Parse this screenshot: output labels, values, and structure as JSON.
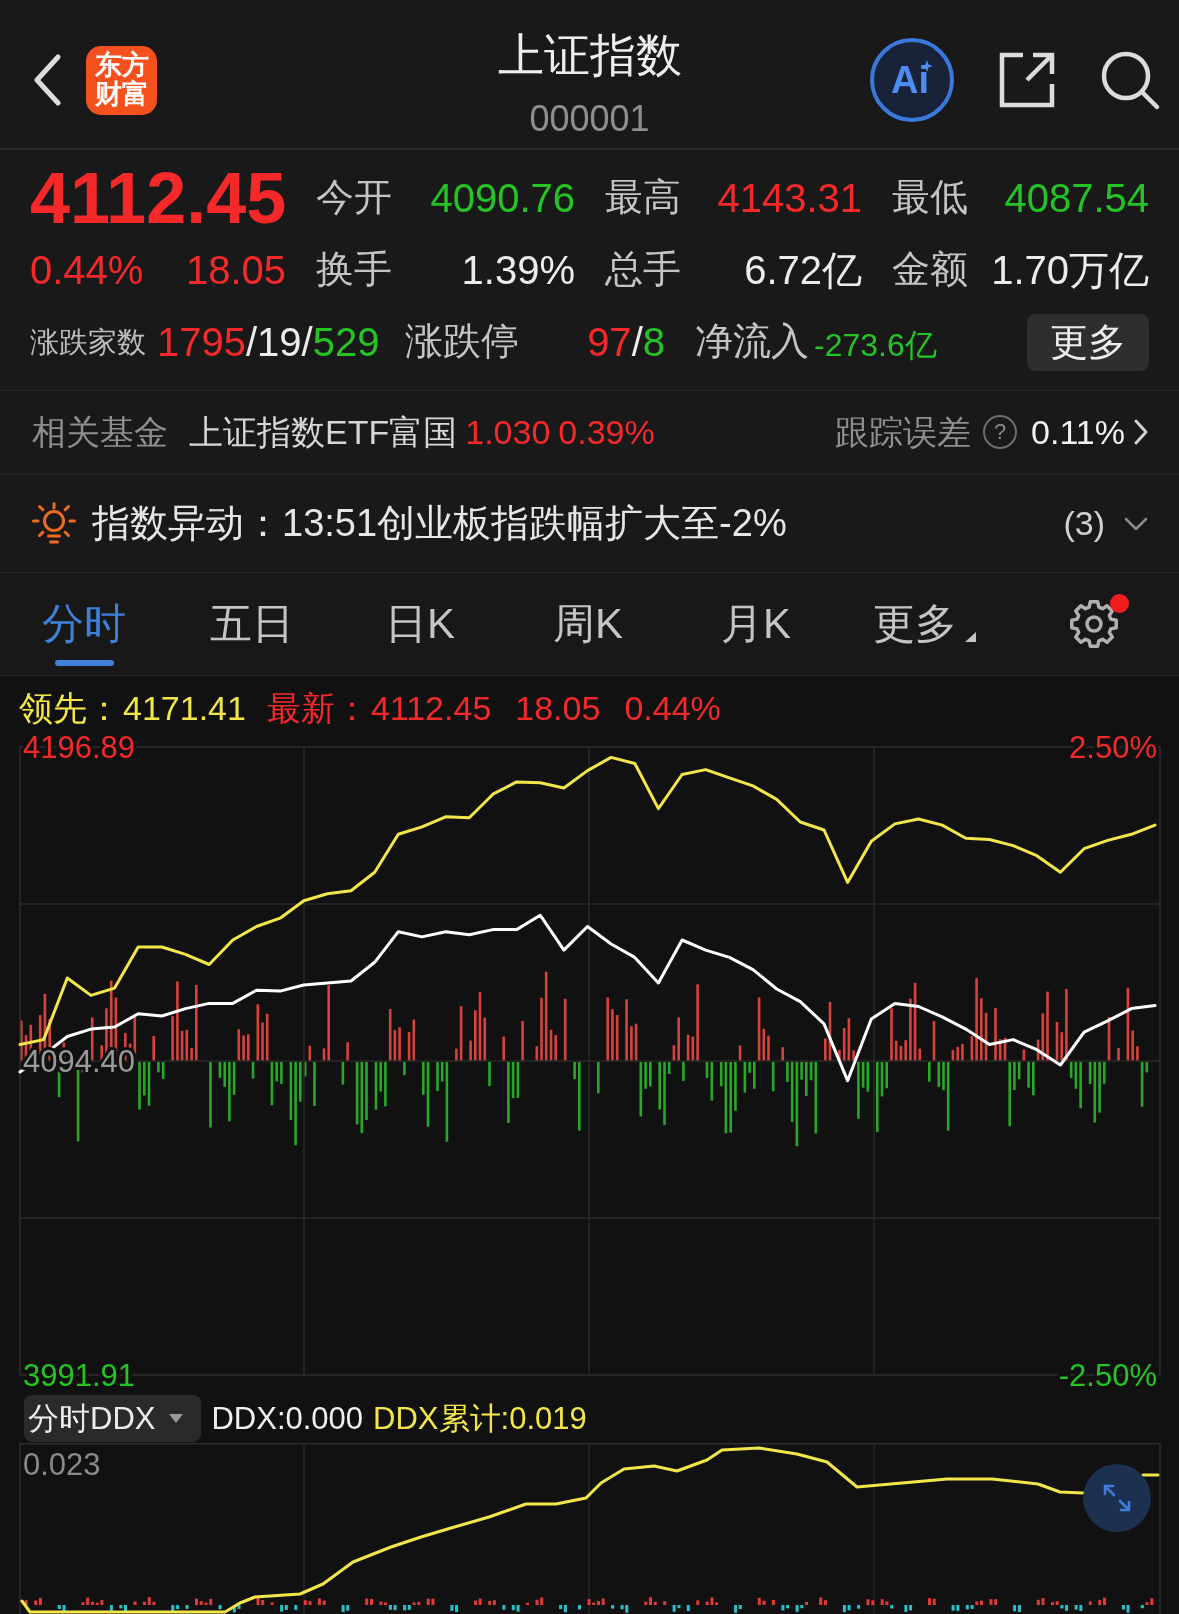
{
  "header": {
    "logo": "东方财富",
    "title": "上证指数",
    "code": "000001",
    "ai_label": "Ai"
  },
  "quote": {
    "price": "4112.45",
    "change_percent": "0.44%",
    "change": "18.05",
    "color": "#f5282a",
    "stats": [
      {
        "label": "今开",
        "value": "4090.76",
        "color": "#25c425"
      },
      {
        "label": "最高",
        "value": "4143.31",
        "color": "#f5282a"
      },
      {
        "label": "最低",
        "value": "4087.54",
        "color": "#25c425"
      },
      {
        "label": "换手",
        "value": "1.39%",
        "color": "#ececec"
      },
      {
        "label": "总手",
        "value": "6.72亿",
        "color": "#ececec"
      },
      {
        "label": "金额",
        "value": "1.70万亿",
        "color": "#ececec"
      }
    ],
    "breadth": {
      "label": "涨跌家数",
      "parts": [
        {
          "text": "1795",
          "color": "#f5282a"
        },
        {
          "text": "/19/",
          "color": "#ececec"
        },
        {
          "text": "529",
          "color": "#25c425"
        }
      ]
    },
    "limits": {
      "label": "涨跌停",
      "parts": [
        {
          "text": "97",
          "color": "#f5282a"
        },
        {
          "text": "/",
          "color": "#ececec"
        },
        {
          "text": "8",
          "color": "#25c425"
        }
      ]
    },
    "net_inflow": {
      "label": "净流入",
      "value": "-273.6亿",
      "color": "#25c425"
    },
    "more_button": "更多"
  },
  "fund": {
    "label": "相关基金",
    "name": "上证指数ETF富国",
    "price": "1.030",
    "change": "0.39%",
    "color": "#f5282a",
    "tracking_label": "跟踪误差",
    "help_mark": "?",
    "tracking_value": "0.11%"
  },
  "alert": {
    "text": "指数异动：13:51创业板指跌幅扩大至-2%",
    "count": "(3)",
    "expanded": false
  },
  "tabs": [
    {
      "label": "分时",
      "selected": true
    },
    {
      "label": "五日",
      "selected": false
    },
    {
      "label": "日K",
      "selected": false
    },
    {
      "label": "周K",
      "selected": false
    },
    {
      "label": "月K",
      "selected": false
    },
    {
      "label": "更多",
      "selected": false,
      "kind": "menu"
    }
  ],
  "settings": {
    "notification": true
  },
  "legend": [
    {
      "label": "领先：",
      "values": [
        "4171.41"
      ],
      "color": "#f3e64b"
    },
    {
      "label": "最新：",
      "values": [
        "4112.45",
        "18.05",
        "0.44%"
      ],
      "color": "#f5282a"
    }
  ],
  "intraday_chart": {
    "right_labels": [
      {
        "text": "2.50%",
        "color": "#f5282a"
      },
      {
        "text": "-2.50%",
        "color": "#25c425"
      }
    ],
    "chart_data": {
      "type": "line",
      "grid": true,
      "categories": [
        null,
        null,
        null,
        null,
        null,
        null,
        null,
        null,
        null,
        null,
        null,
        null,
        null,
        null,
        null,
        null,
        null,
        null,
        null,
        null,
        null,
        null,
        null,
        null,
        null,
        null,
        null,
        null,
        null,
        null,
        null,
        null,
        null,
        null,
        null,
        null,
        null,
        null,
        null,
        null,
        null,
        null,
        null,
        null,
        null,
        null,
        null,
        null,
        null
      ],
      "ylim": [
        3991.91,
        4196.89
      ],
      "yticks": [
        {
          "value": 4196.89,
          "label": "4196.89"
        },
        {
          "value": 4094.4,
          "label": "4094.40"
        },
        {
          "value": 3991.91,
          "label": "3991.91"
        }
      ],
      "series": [
        {
          "color": "#f3e64b",
          "values": [
            4099.8,
            4101.4,
            4121.5,
            4115.8,
            4118.2,
            4131.6,
            4131.6,
            4129.2,
            4125.9,
            4133.9,
            4138.3,
            4141.0,
            4146.7,
            4149.0,
            4150.0,
            4156.0,
            4168.4,
            4170.8,
            4174.1,
            4173.8,
            4181.5,
            4185.5,
            4185.2,
            4183.5,
            4189.2,
            4193.5,
            4191.5,
            4176.8,
            4187.9,
            4189.5,
            4186.8,
            4184.2,
            4179.8,
            4172.4,
            4169.8,
            4152.7,
            4166.1,
            4171.8,
            4173.4,
            4171.4,
            4167.1,
            4166.7,
            4164.7,
            4161.4,
            4156.0,
            4163.7,
            4166.4,
            4168.4,
            4171.4
          ]
        },
        {
          "color": "#ffffff",
          "values": [
            4090.8,
            4096.4,
            4102.4,
            4104.8,
            4105.5,
            4109.8,
            4109.1,
            4111.5,
            4113.2,
            4113.2,
            4117.5,
            4117.2,
            4119.2,
            4119.9,
            4120.5,
            4126.6,
            4136.6,
            4134.9,
            4136.6,
            4135.6,
            4137.3,
            4137.3,
            4142.0,
            4130.6,
            4138.3,
            4132.6,
            4128.2,
            4119.9,
            4133.9,
            4130.6,
            4128.2,
            4124.2,
            4117.9,
            4113.8,
            4106.5,
            4088.0,
            4108.1,
            4113.2,
            4112.2,
            4108.8,
            4104.8,
            4099.8,
            4101.4,
            4098.1,
            4093.1,
            4103.8,
            4107.5,
            4111.5,
            4112.5
          ]
        }
      ]
    }
  },
  "ddx": {
    "selector": "分时DDX",
    "readings": [
      {
        "kind": "ddx",
        "text": "DDX:0.000"
      },
      {
        "kind": "cumulative",
        "text": "DDX累计:0.019"
      }
    ],
    "top_label": "0.023"
  }
}
